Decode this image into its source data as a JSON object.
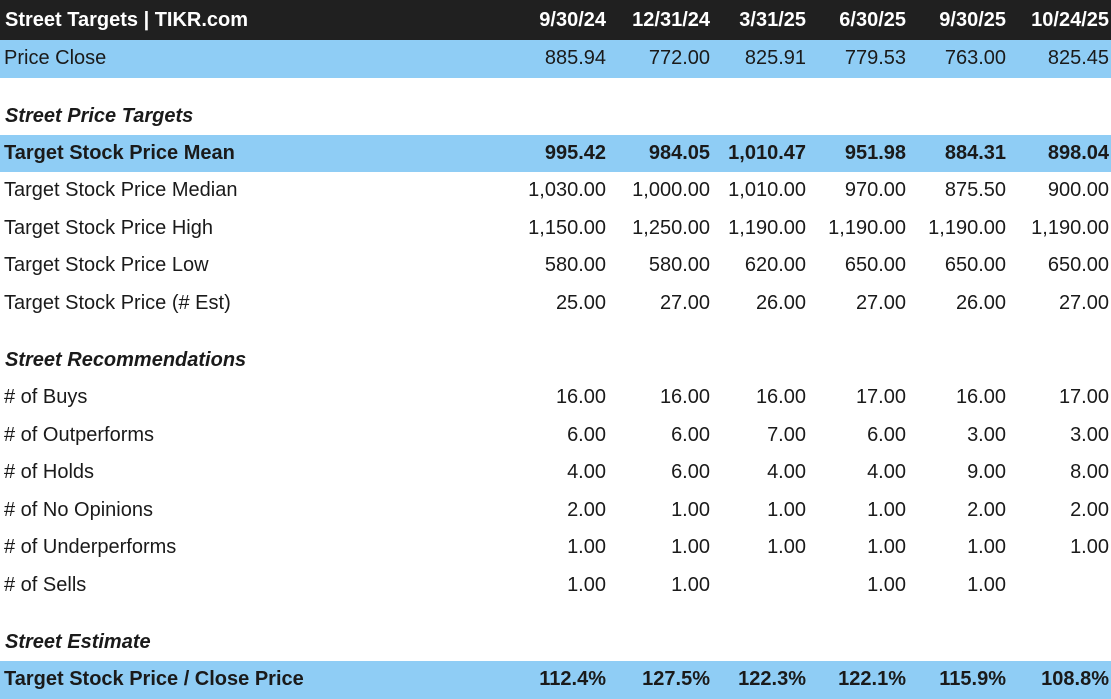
{
  "header": {
    "title": "Street Targets | TIKR.com",
    "dates": [
      "9/30/24",
      "12/31/24",
      "3/31/25",
      "6/30/25",
      "9/30/25",
      "10/24/25"
    ]
  },
  "price_close": {
    "label": "Price Close",
    "values": [
      "885.94",
      "772.00",
      "825.91",
      "779.53",
      "763.00",
      "825.45"
    ]
  },
  "sections": {
    "targets": "Street Price Targets",
    "recommendations": "Street Recommendations",
    "estimate": "Street Estimate"
  },
  "targets": [
    {
      "label": "Target Stock Price Mean",
      "values": [
        "995.42",
        "984.05",
        "1,010.47",
        "951.98",
        "884.31",
        "898.04"
      ]
    },
    {
      "label": "Target Stock Price Median",
      "values": [
        "1,030.00",
        "1,000.00",
        "1,010.00",
        "970.00",
        "875.50",
        "900.00"
      ]
    },
    {
      "label": "Target Stock Price High",
      "values": [
        "1,150.00",
        "1,250.00",
        "1,190.00",
        "1,190.00",
        "1,190.00",
        "1,190.00"
      ]
    },
    {
      "label": "Target Stock Price Low",
      "values": [
        "580.00",
        "580.00",
        "620.00",
        "650.00",
        "650.00",
        "650.00"
      ]
    },
    {
      "label": "Target Stock Price (# Est)",
      "values": [
        "25.00",
        "27.00",
        "26.00",
        "27.00",
        "26.00",
        "27.00"
      ]
    }
  ],
  "recommendations": [
    {
      "label": "# of Buys",
      "values": [
        "16.00",
        "16.00",
        "16.00",
        "17.00",
        "16.00",
        "17.00"
      ]
    },
    {
      "label": "# of Outperforms",
      "values": [
        "6.00",
        "6.00",
        "7.00",
        "6.00",
        "3.00",
        "3.00"
      ]
    },
    {
      "label": "# of Holds",
      "values": [
        "4.00",
        "6.00",
        "4.00",
        "4.00",
        "9.00",
        "8.00"
      ]
    },
    {
      "label": "# of No Opinions",
      "values": [
        "2.00",
        "1.00",
        "1.00",
        "1.00",
        "2.00",
        "2.00"
      ]
    },
    {
      "label": "# of Underperforms",
      "values": [
        "1.00",
        "1.00",
        "1.00",
        "1.00",
        "1.00",
        "1.00"
      ]
    },
    {
      "label": "# of Sells",
      "values": [
        "1.00",
        "1.00",
        "",
        "1.00",
        "1.00",
        ""
      ]
    }
  ],
  "estimate": {
    "label": "Target Stock Price / Close Price",
    "values": [
      "112.4%",
      "127.5%",
      "122.3%",
      "122.1%",
      "115.9%",
      "108.8%"
    ]
  },
  "colors": {
    "header_bg": "#202020",
    "highlight_bg": "#8fcdf5"
  }
}
